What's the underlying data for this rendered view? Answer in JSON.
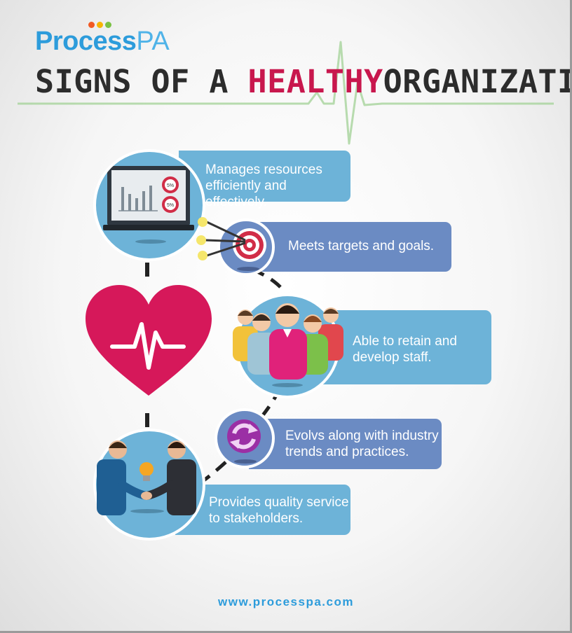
{
  "brand": {
    "name_part1": "Process",
    "name_part2": "PA",
    "dot_colors": [
      "#f15a24",
      "#f7b500",
      "#7ac143"
    ]
  },
  "title": {
    "part1": "SIGNS OF A ",
    "highlight": "HEALTHY",
    "part2": "ORGANIZATION"
  },
  "nodes": [
    {
      "id": "resources",
      "text_line1": "Manages resources",
      "text_line2": "efficiently and effectively."
    },
    {
      "id": "targets",
      "text_line1": "Meets targets and goals."
    },
    {
      "id": "staff",
      "text_line1": "Able to retain and",
      "text_line2": "develop staff."
    },
    {
      "id": "evolve",
      "text_line1": "Evolvs along with industry",
      "text_line2": "trends and practices."
    },
    {
      "id": "service",
      "text_line1": "Provides quality service",
      "text_line2": "to stakeholders."
    }
  ],
  "monitor": {
    "badge1": "5%",
    "badge2": "5%"
  },
  "footer": {
    "url": "www.processpa.com"
  },
  "colors": {
    "brand_blue": "#2d9cdb",
    "accent_red": "#c8174d",
    "pill_blue": "#6db3d8",
    "pill_navy": "#6b8bc3",
    "pulse_green": "#a6d39b",
    "title_dark": "#2c2c2c"
  },
  "icons": [
    "monitor-chart-icon",
    "target-arrows-icon",
    "heart-pulse-icon",
    "team-people-icon",
    "refresh-arrows-icon",
    "handshake-icon"
  ]
}
